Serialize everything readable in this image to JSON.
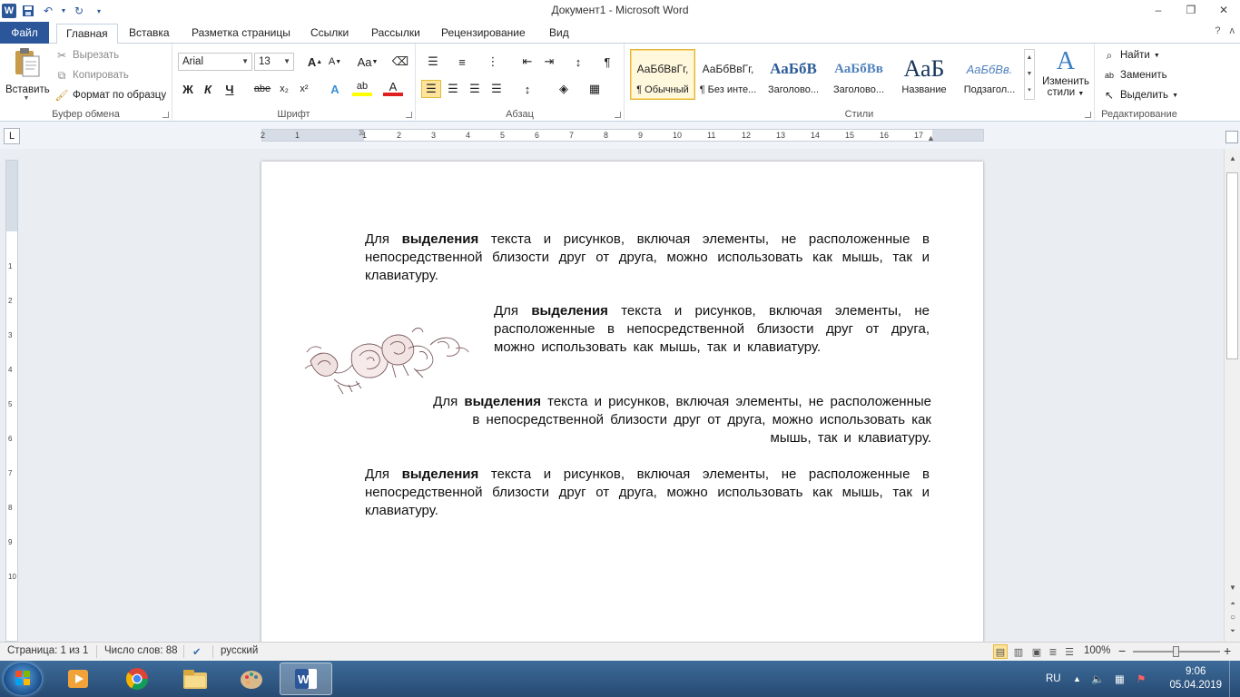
{
  "window": {
    "title": "Документ1 - Microsoft Word",
    "minimize": "‒",
    "maximize": "❐",
    "close": "✕"
  },
  "tabs": [
    "Файл",
    "Главная",
    "Вставка",
    "Разметка страницы",
    "Ссылки",
    "Рассылки",
    "Рецензирование",
    "Вид"
  ],
  "ribbon": {
    "clipboard": {
      "label": "Буфер обмена",
      "paste": "Вставить",
      "cut": "Вырезать",
      "copy": "Копировать",
      "format_painter": "Формат по образцу"
    },
    "font": {
      "label": "Шрифт",
      "font_name": "Arial",
      "font_size": "13",
      "bold": "Ж",
      "italic": "К",
      "underline": "Ч",
      "strike": "abe",
      "subscript": "x₂",
      "superscript": "x²",
      "grow": "A",
      "shrink": "A",
      "case": "Aa",
      "effects": "A",
      "highlight": "ab",
      "font_color": "A",
      "font_color_value": "#e02020",
      "highlight_value": "#ffff00"
    },
    "paragraph": {
      "label": "Абзац",
      "pilcrow": "¶"
    },
    "styles": {
      "label": "Стили",
      "items": [
        {
          "sample": "АаБбВвГг,",
          "name": "¶ Обычный"
        },
        {
          "sample": "АаБбВвГг,",
          "name": "¶ Без инте..."
        },
        {
          "sample": "АаБбВ",
          "name": "Заголово..."
        },
        {
          "sample": "АаБбВв",
          "name": "Заголово..."
        },
        {
          "sample": "АаБ",
          "name": "Название"
        },
        {
          "sample": "АаБбВв.",
          "name": "Подзагол..."
        }
      ],
      "change_line1": "Изменить",
      "change_line2": "стили"
    },
    "editing": {
      "label": "Редактирование",
      "find": "Найти",
      "replace": "Заменить",
      "select": "Выделить"
    }
  },
  "ruler": {
    "corner": "L",
    "h_ticks": [
      "2",
      "1",
      "1",
      "2",
      "3",
      "4",
      "5",
      "6",
      "7",
      "8",
      "9",
      "10",
      "11",
      "12",
      "13",
      "14",
      "15",
      "16",
      "17"
    ],
    "v_ticks": [
      "1",
      "2",
      "3",
      "4",
      "5",
      "6",
      "7",
      "8",
      "9",
      "10"
    ]
  },
  "document": {
    "paragraphs": [
      {
        "pre": "Для ",
        "bold": "выделения",
        "post": " текста и рисунков, включая элементы, не расположенные в непосредственной близости друг от друга, можно использовать как мышь, так и клавиатуру.",
        "align": "left"
      },
      {
        "pre": "Для ",
        "bold": "выделения",
        "post": " текста и рисунков, включая элементы, не расположенные в непосредственной близости друг от друга, можно использовать как мышь, так и клавиатуру.",
        "align": "left"
      },
      {
        "pre": "Для ",
        "bold": "выделения",
        "post": " текста и рисунков, включая элементы, не расположенные в непосредственной близости друг от друга, можно использовать как мышь, так и клавиатуру.",
        "align": "right"
      },
      {
        "pre": "Для ",
        "bold": "выделения",
        "post": " текста и рисунков, включая элементы, не расположенные в непосредственной близости друг от друга, можно использовать как мышь, так и клавиатуру.",
        "align": "left"
      }
    ]
  },
  "status": {
    "page": "Страница: 1 из 1",
    "words": "Число слов: 88",
    "language": "русский",
    "zoom": "100%",
    "zoom_minus": "−",
    "zoom_plus": "+"
  },
  "taskbar": {
    "lang": "RU",
    "time": "9:06",
    "date": "05.04.2019"
  }
}
